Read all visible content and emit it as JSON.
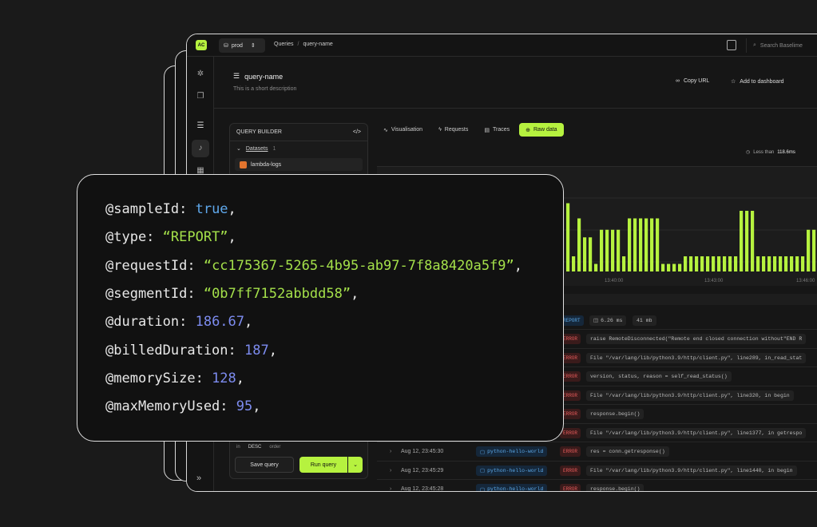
{
  "topbar": {
    "logo": "AC",
    "env": "prod",
    "breadcrumb": [
      "Queries",
      "query-name"
    ],
    "search_placeholder": "Search Baselime"
  },
  "query": {
    "title": "query-name",
    "description": "This is a short description",
    "actions": [
      "Copy URL",
      "Add to dashboard"
    ]
  },
  "builder": {
    "title": "QUERY BUILDER",
    "code_icon": "</>",
    "datasets_label": "Datasets",
    "datasets_count": "1",
    "dataset": "lambda-logs",
    "sort_in": "in",
    "sort_dir": "DESC",
    "sort_order": "order",
    "save_label": "Save query",
    "run_label": "Run query"
  },
  "tabs": [
    {
      "label": "Visualisation",
      "icon": "line-chart-icon"
    },
    {
      "label": "Requests",
      "icon": "lightning-icon"
    },
    {
      "label": "Traces",
      "icon": "traces-icon"
    },
    {
      "label": "Raw data",
      "icon": "raw-data-icon",
      "active": true
    }
  ],
  "limit": {
    "prefix": "Less than",
    "value": "118.6ms"
  },
  "chart_data": {
    "type": "bar",
    "title": "",
    "x_ticks": [
      "13:40:00",
      "13:43:00",
      "13:46:00"
    ],
    "values": [
      0.9,
      0.2,
      0.7,
      0.45,
      0.45,
      0.1,
      0.55,
      0.55,
      0.55,
      0.55,
      0.2,
      0.7,
      0.7,
      0.7,
      0.7,
      0.7,
      0.7,
      0.1,
      0.1,
      0.1,
      0.1,
      0.2,
      0.2,
      0.2,
      0.2,
      0.2,
      0.2,
      0.2,
      0.2,
      0.2,
      0.2,
      0.8,
      0.8,
      0.8,
      0.2,
      0.2,
      0.2,
      0.2,
      0.2,
      0.2,
      0.2,
      0.2,
      0.2,
      0.55,
      0.55
    ],
    "color": "#b6f23f"
  },
  "rows": [
    {
      "ts": "",
      "service": "",
      "level": "REPORT",
      "message": "",
      "extra1": "6.26 ms",
      "extra2": "41 mb"
    },
    {
      "ts": "",
      "service": "",
      "level": "ERROR",
      "message": "raise RemoteDisconnected(\"Remote end closed connection without\"END R"
    },
    {
      "ts": "",
      "service": "",
      "level": "ERROR",
      "message": "File \"/var/lang/lib/python3.9/http/client.py\", line289, in_read_stat"
    },
    {
      "ts": "",
      "service": "",
      "level": "ERROR",
      "message": "version, status, reason = self_read_status()"
    },
    {
      "ts": "",
      "service": "",
      "level": "ERROR",
      "message": "File \"/var/lang/lib/python3.9/http/client.py\", line320, in begin"
    },
    {
      "ts": "",
      "service": "",
      "level": "ERROR",
      "message": "response.begin()"
    },
    {
      "ts": "",
      "service": "",
      "level": "ERROR",
      "message": "File \"/var/lang/lib/python3.9/http/client.py\", line1377, in getrespo"
    },
    {
      "ts": "Aug 12, 23:45:30",
      "service": "python-hello-world",
      "level": "ERROR",
      "message": "res = conn.getresponse()"
    },
    {
      "ts": "Aug 12, 23:45:29",
      "service": "python-hello-world",
      "level": "ERROR",
      "message": "File \"/var/lang/lib/python3.9/http/client.py\", line1440, in begin"
    },
    {
      "ts": "Aug 12, 23:45:28",
      "service": "python-hello-world",
      "level": "ERROR",
      "message": "response.begin()"
    }
  ],
  "code": {
    "lines": [
      {
        "key": "@sampleId",
        "value": "true",
        "kind": "bool"
      },
      {
        "key": "@type",
        "value": "“REPORT”",
        "kind": "str"
      },
      {
        "key": "@requestId",
        "value": "“cc175367-5265-4b95-ab97-7f8a8420a5f9”",
        "kind": "str"
      },
      {
        "key": "@segmentId",
        "value": "“0b7ff7152abbdd58”",
        "kind": "str"
      },
      {
        "key": "@duration",
        "value": "186.67",
        "kind": "num"
      },
      {
        "key": "@billedDuration",
        "value": "187",
        "kind": "num"
      },
      {
        "key": "@memorySize",
        "value": "128",
        "kind": "num"
      },
      {
        "key": "@maxMemoryUsed",
        "value": "95",
        "kind": "num"
      }
    ]
  }
}
